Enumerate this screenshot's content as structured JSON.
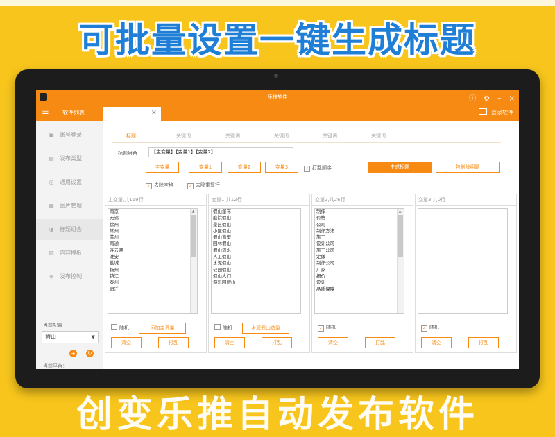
{
  "banner": {
    "headline": "可批量设置一键生成标题",
    "footer": "创变乐推自动发布软件"
  },
  "app": {
    "window_title": "乐推软件",
    "menu_label": "软件列表",
    "login_label": "登录软件"
  },
  "sidebar": {
    "items": [
      {
        "label": "账号登录",
        "icon": "▣"
      },
      {
        "label": "发布类型",
        "icon": "▤"
      },
      {
        "label": "通用设置",
        "icon": "◎"
      },
      {
        "label": "图片管理",
        "icon": "▦"
      },
      {
        "label": "标题组合",
        "icon": "◑"
      },
      {
        "label": "内容模板",
        "icon": "▨"
      },
      {
        "label": "发布控制",
        "icon": "◈"
      }
    ],
    "config_label": "当前配置",
    "config_value": "假山",
    "platform_label": "当前平台："
  },
  "subtabs": [
    "标题",
    "关键词",
    "关键词",
    "关键词",
    "关键词",
    "关键词"
  ],
  "combo": {
    "label": "标题组合",
    "value": "【主变量】【变量1】【变量2】"
  },
  "var_buttons": [
    "主变量",
    "变量1",
    "变量2",
    "变量3"
  ],
  "shuffle_label": "打乱顺序",
  "generate_label": "生成标题",
  "clear_label": "包删除组题",
  "options": [
    "去除空格",
    "去除重复行"
  ],
  "panels": [
    {
      "title": "主变量,共119行",
      "items": [
        "南京",
        "无锡",
        "徐州",
        "常州",
        "苏州",
        "南通",
        "连云港",
        "淮安",
        "盐城",
        "扬州",
        "镇江",
        "泰州",
        "宿迁"
      ],
      "random_checked": false,
      "random_label": "随机",
      "extra_label": "添加主词量",
      "btn1": "清空",
      "btn2": "打乱"
    },
    {
      "title": "变量1,共12行",
      "items": [
        "假山瀑布",
        "庭院假山",
        "景区假山",
        "小区假山",
        "假山造型",
        "园林假山",
        "假山流水",
        "人工假山",
        "水泥假山",
        "公园假山",
        "假山大门",
        "游乐园假山"
      ],
      "random_checked": false,
      "random_label": "随机",
      "extra_label": "水泥假山造型",
      "btn1": "清空",
      "btn2": "打乱"
    },
    {
      "title": "变量2,共26行",
      "items": [
        "制作",
        "价格",
        "公司",
        "制作方法",
        "施工",
        "设计公司",
        "施工公司",
        "定做",
        "制作公司",
        "厂家",
        "报价",
        "设计",
        "品质保障"
      ],
      "random_checked": true,
      "random_label": "随机",
      "extra_label": "",
      "btn1": "清空",
      "btn2": "打乱"
    },
    {
      "title": "变量3,共0行",
      "items": [],
      "random_checked": true,
      "random_label": "随机",
      "extra_label": "",
      "btn1": "清空",
      "btn2": "打乱"
    }
  ],
  "colors": {
    "accent": "#f78a12",
    "banner_bg": "#f7c51c",
    "headline": "#1f7fd6"
  }
}
